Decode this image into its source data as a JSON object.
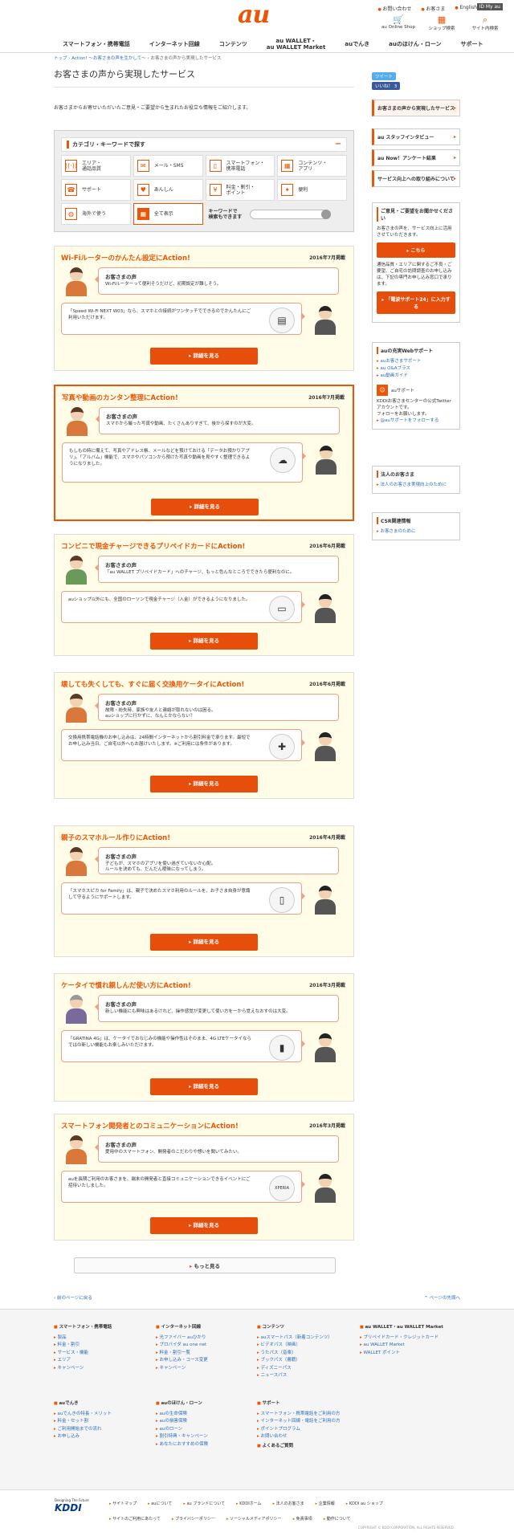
{
  "header": {
    "logo": "au",
    "toplinks": [
      "お問い合わせ",
      "お客さま",
      "English"
    ],
    "top_badge": "ID",
    "top_right": "My au",
    "icons": [
      {
        "label": "au Online Shop",
        "icon": "cart-icon"
      },
      {
        "label": "ショップ検索",
        "icon": "shop-icon"
      },
      {
        "label": "サイト内検索",
        "icon": "search-icon"
      }
    ],
    "nav": [
      "スマートフォン・携帯電話",
      "インターネット回線",
      "コンテンツ",
      "au WALLET・\nau WALLET Market",
      "auでんき",
      "auのほけん・ローン",
      "サポート"
    ]
  },
  "breadcrumb": [
    "トップ",
    "Action! ～お客さまの声を生かして～",
    "お客さまの声から実現したサービス"
  ],
  "page": {
    "title": "お客さまの声から実現したサービス",
    "intro": "お客さまからお寄せいただいたご意見・ご要望から生まれたお役立ち情報をご紹介します。"
  },
  "search": {
    "heading": "カテゴリ・キーワードで探す",
    "categories": [
      {
        "label": "エリア・\n通話品質",
        "icon": "signal-icon",
        "g": "((·))"
      },
      {
        "label": "メール・SMS",
        "icon": "mail-icon",
        "g": "✉"
      },
      {
        "label": "スマートフォン・\n携帯電話",
        "icon": "phone-icon",
        "g": "▯"
      },
      {
        "label": "コンテンツ・\nアプリ",
        "icon": "apps-icon",
        "g": "▦"
      },
      {
        "label": "サポート",
        "icon": "support-icon",
        "g": "☎"
      },
      {
        "label": "あんしん",
        "icon": "heart-icon",
        "g": "♥"
      },
      {
        "label": "料金・割引・\nポイント",
        "icon": "yen-icon",
        "g": "¥"
      },
      {
        "label": "便利",
        "icon": "star-icon",
        "g": "✦"
      },
      {
        "label": "海外で使う",
        "icon": "globe-icon",
        "g": "◍"
      },
      {
        "label": "全て表示",
        "icon": "grid-icon",
        "g": "▦"
      }
    ],
    "keyword_label": "キーワードで\n検索もできます",
    "keyword_placeholder": ""
  },
  "cases": [
    {
      "title": "Wi-Fiルーターのかんたん設定にAction!",
      "date": "2016年7月掲載",
      "voice_title": "お客さまの声",
      "voice": "Wi-Fiルーターって便利そうだけど、初期設定が難しそう。",
      "reply": "「Speed Wi-Fi NEXT W03」なら、スマホとの接続がワンタッチでできるのでかんたんにご利用いただけます。",
      "img": "router-icon",
      "g": "▤",
      "button": "詳細を見る",
      "highlight": false
    },
    {
      "title": "写真や動画のカンタン整理にAction!",
      "date": "2016年7月掲載",
      "voice_title": "お客さまの声",
      "voice": "スマホから撮った写真や動画、たくさんありすぎて、後から探すのが大変。",
      "reply": "もしもの時に備えて、写真やアドレス帳、メールなどを預けておける「データお預かりアプリ」。「アルバム」機能で、スマホやパソコンから預けた写真や動画を見やすく整理できるようになりました。",
      "img": "cloud-icon",
      "g": "☁",
      "button": "詳細を見る",
      "highlight": true
    },
    {
      "title": "コンビニで現金チャージできるプリペイドカードにAction!",
      "date": "2016年6月掲載",
      "voice_title": "お客さまの声",
      "voice": "「au WALLET プリペイドカード」へのチャージ、もっと色んなところでできたら便利なのに。",
      "reply": "auショップ以外にも、全国のローソンで現金チャージ（入金）ができるようになりました。",
      "img": "card-icon",
      "g": "▭",
      "button": "詳細を見る",
      "highlight": false
    },
    {
      "title": "壊しても失くしても、すぐに届く交換用ケータイにAction!",
      "date": "2016年6月掲載",
      "voice_title": "お客さまの声",
      "voice": "故障・紛失時、家族や友人と連絡が取れないのは困る。\nauショップに行かずに、なんとかならない？",
      "reply": "交換用携帯電話機のお申し込みは、24時間インターネットから割引料金で承ります。最短でお申し込み当日、ご自宅以外へもお届けいたします。※ご利用には条件があります。",
      "img": "first-aid-icon",
      "g": "✚",
      "button": "詳細を見る",
      "highlight": false
    },
    {
      "title": "親子のスマホルール作りにAction!",
      "date": "2016年4月掲載",
      "voice_title": "お客さまの声",
      "voice": "子どもが、スマホのアプリを使い過ぎていないか心配。\nルールを決めても、だんだん曖昧になってしまう。",
      "reply": "「スマホスピカ for Family」は、親子で決めたスマホ利用のルールを、お子さま自身が意識して守るようにサポートします。",
      "img": "smartphone-icon",
      "g": "▯",
      "button": "詳細を見る",
      "highlight": false
    },
    {
      "title": "ケータイで慣れ親しんだ使い方にAction!",
      "date": "2016年3月掲載",
      "voice_title": "お客さまの声",
      "voice": "新しい機能にも興味はあるけれど、操作感覚が変更して使い方を一から覚えなおすのは大変。",
      "reply": "「GRATINA 4G」は、ケータイでおなじみの機能や操作性はそのまま、4G LTEケータイならではの新しい機能もお楽しみいただけます。",
      "img": "flip-phone-icon",
      "g": "▮",
      "button": "詳細を見る",
      "highlight": false
    },
    {
      "title": "スマートフォン開発者とのコミュニケーションにAction!",
      "date": "2016年3月掲載",
      "voice_title": "お客さまの声",
      "voice": "愛用中のスマートフォン、開発者のこだわりや想いを聞いてみたい。",
      "reply": "auを長期ご利用のお客さまを、端末の開発者と直接コミュニケーションできるイベントにご招待いたしました。",
      "img": "xperia-logo",
      "g": "XPERIA",
      "button": "詳細を見る",
      "highlight": false
    }
  ],
  "more_button": "もっと見る",
  "pagelinks": {
    "back": "前のページに戻る",
    "top": "ページの先頭へ"
  },
  "sidebar": {
    "tweet": "ツイート",
    "like": "いいね！ 3",
    "links": [
      "お客さまの声から実現したサービス",
      "au スタッフインタビュー",
      "au Now！アンケート結果",
      "サービス向上への取り組みについて"
    ],
    "opinion": {
      "title": "ご意見・ご要望をお聞かせください",
      "text": "お客さまの声を、サービス向上に活用させていただきます。",
      "button": "こちら",
      "text2": "通信品質・エリアに関するご不良・ご要望、ご自宅の訪問調査のお申し込みは、下記の専門お申し込み窓口で承ります。",
      "button2": "「電波サポート24」に入力する"
    },
    "web": {
      "title": "auの充実Webサポート",
      "links": [
        "auお客さまサポート",
        "au Q&Aプラス",
        "au動画ガイド"
      ],
      "name": "auサポート",
      "desc": "KDDIお客さまセンターの公式Twitterアカウントです。",
      "follow": "フォローをお願いします。",
      "twlink": "@auサポートをフォローする"
    },
    "corp": {
      "title": "法人のお客さま",
      "link": "法人のお客さま実現向上のために"
    },
    "csr": {
      "title": "CSR関連情報",
      "link": "お客さまのために"
    }
  },
  "footer": {
    "cols": [
      {
        "h": "スマートフォン・携帯電話",
        "items": [
          "製品",
          "料金・割引",
          "サービス・機能",
          "エリア",
          "キャンペーン"
        ]
      },
      {
        "h": "インターネット回線",
        "items": [
          "光ファイバー auひかり",
          "プロバイダ au one net",
          "料金・割引一覧",
          "お申し込み・コース変更",
          "キャンペーン"
        ]
      },
      {
        "h": "コンテンツ",
        "items": [
          "auスマートパス（新着コンテンツ）",
          "ビデオパス（映画）",
          "うたパス（音楽）",
          "ブックパス（書籍）",
          "ディズニーパス",
          "ニュースパス"
        ]
      },
      {
        "h": "au WALLET・au WALLET Market",
        "items": [
          "プリペイドカード・クレジットカード",
          "au WALLET Market",
          "WALLET ポイント"
        ]
      },
      {
        "h": "auでんき",
        "items": [
          "auでんきの特長・メリット",
          "料金・セット割",
          "ご利用開始までの流れ",
          "お申し込み"
        ]
      },
      {
        "h": "auのほけん・ローン",
        "items": [
          "auの生命保険",
          "auの損害保険",
          "auのローン",
          "割引特典・キャンペーン",
          "あなたにおすすめの保険"
        ]
      },
      {
        "h": "サポート",
        "items": [
          "スマートフォン・携帯電話をご利用の方",
          "インターネット回線・電話をご利用の方",
          "ポイントプログラム",
          "お問い合わせ"
        ],
        "extra": "よくあるご質問"
      }
    ],
    "brand": "KDDI",
    "tagline": "Designing The Future",
    "links1": [
      "サイトマップ",
      "auについて",
      "au ブランドについて",
      "KDDIホーム",
      "法人のお客さま",
      "企業情報",
      "KDDI au ショップ"
    ],
    "links2": [
      "サイトのご利用にあたって",
      "プライバシーポリシー",
      "ソーシャルメディアポリシー",
      "免責事項",
      "動作について"
    ],
    "copyright": "COPYRIGHT © KDDI CORPORATION, ALL RIGHTS RESERVED."
  },
  "colors": {
    "accent": "#eb5505",
    "link": "#2a6bbf",
    "case_bg": "#fffde8"
  }
}
